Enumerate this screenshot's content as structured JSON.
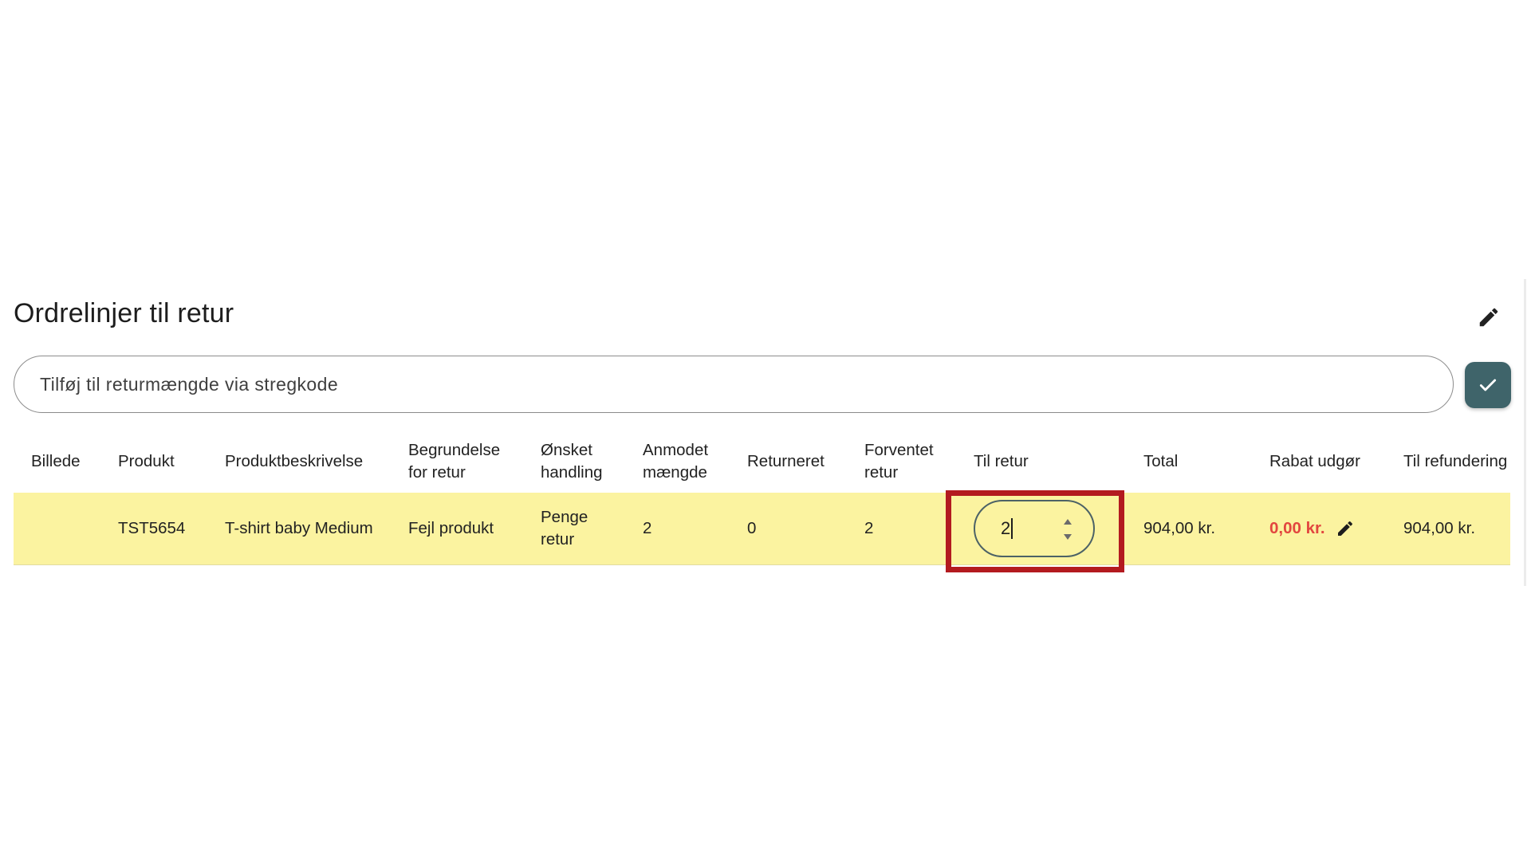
{
  "section": {
    "title": "Ordrelinjer til retur"
  },
  "icons": {
    "edit": "pencil-icon",
    "confirm": "check-icon",
    "spinner_up": "caret-up-icon",
    "spinner_down": "caret-down-icon"
  },
  "colors": {
    "row_highlight": "#fbf3a0",
    "confirm_button": "#3f646a",
    "discount_text": "#e2463f",
    "annotation_box": "#b31a1f"
  },
  "barcode_input": {
    "placeholder": "Tilføj til returmængde via stregkode",
    "value": ""
  },
  "table": {
    "headers": {
      "image": "Billede",
      "product": "Produkt",
      "description": "Produktbeskrivelse",
      "reason": "Begrundelse for retur",
      "action": "Ønsket handling",
      "requested": "Anmodet mængde",
      "returned": "Returneret",
      "expected": "Forventet retur",
      "to_return": "Til retur",
      "total": "Total",
      "discount": "Rabat udgør",
      "refund": "Til refundering"
    },
    "rows": [
      {
        "image": "",
        "product": "TST5654",
        "description": "T-shirt baby Medium",
        "reason": "Fejl produkt",
        "action": "Penge retur",
        "requested": "2",
        "returned": "0",
        "expected": "2",
        "to_return": "2",
        "total": "904,00 kr.",
        "discount": "0,00 kr.",
        "refund": "904,00 kr."
      }
    ]
  }
}
